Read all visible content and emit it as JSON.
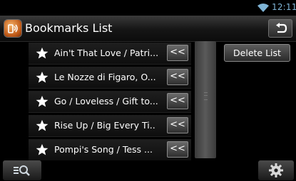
{
  "status": {
    "time": "12:11"
  },
  "header": {
    "title": "Bookmarks List"
  },
  "bookmarks": [
    {
      "label": "Ain't That Love / Patri..."
    },
    {
      "label": "Le Nozze di Figaro, O..."
    },
    {
      "label": "Go / Loveless / Gift to..."
    },
    {
      "label": "Rise Up / Big Every Ti.."
    },
    {
      "label": "Pompi's Song / Tess ..."
    }
  ],
  "skip_label": "<<",
  "actions": {
    "delete_list": "Delete List"
  },
  "colors": {
    "accent": "#7fb4d6",
    "icon_orange": "#d9702a"
  }
}
